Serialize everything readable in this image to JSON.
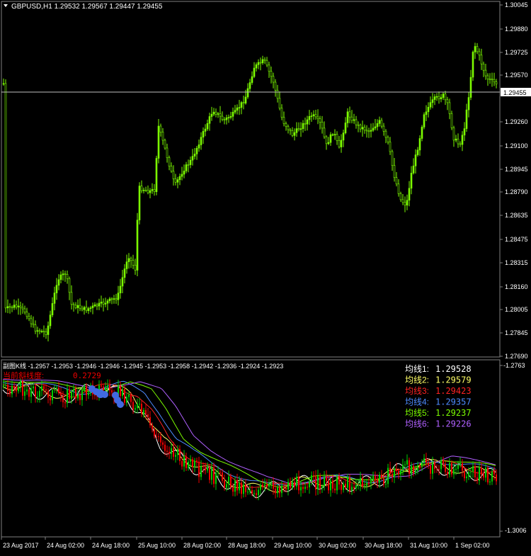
{
  "main_chart": {
    "symbol_header": "GBPUSD,H1  1.29532 1.29567 1.29447 1.29455",
    "price_axis": [
      "1.30045",
      "1.29880",
      "1.29725",
      "1.29570",
      "1.29455",
      "1.29260",
      "1.29100",
      "1.28945",
      "1.28790",
      "1.28635",
      "1.28475",
      "1.28315",
      "1.28160",
      "1.28005",
      "1.27845",
      "1.27690"
    ],
    "current_price_label": "1.29455",
    "colors": {
      "background": "#000000",
      "candle": "#7cfc00",
      "text": "#ffffff",
      "bid_line": "#c0c0c0"
    }
  },
  "indicator": {
    "header": "副图K线 -1.2957 -1.2953 -1.2946 -1.2946 -1.2945 -1.2953 -1.2958 -1.2942 -1.2936 -1.2924 -1.2923",
    "current_slope_label": "当前斜线度:",
    "current_slope_value": "0.2729",
    "axis_top": "-1.2763",
    "axis_bottom": "-1.3006",
    "ma_legend": [
      {
        "label": "均线1:",
        "value": "1.29528",
        "color": "#ffffff"
      },
      {
        "label": "均线2:",
        "value": "1.29579",
        "color": "#ffff66"
      },
      {
        "label": "均线3:",
        "value": "1.29423",
        "color": "#ff2222"
      },
      {
        "label": "均线4:",
        "value": "1.29357",
        "color": "#4e8cff"
      },
      {
        "label": "均线5:",
        "value": "1.29237",
        "color": "#7cfc00"
      },
      {
        "label": "均线6:",
        "value": "1.29226",
        "color": "#b060ff"
      }
    ],
    "colors": {
      "up": "#00cc00",
      "down": "#ee0000",
      "highlight": "#4169e1"
    }
  },
  "time_axis": [
    "23 Aug 2017",
    "24 Aug 02:00",
    "24 Aug 18:00",
    "25 Aug 10:00",
    "28 Aug 02:00",
    "28 Aug 18:00",
    "29 Aug 10:00",
    "30 Aug 02:00",
    "30 Aug 18:00",
    "31 Aug 10:00",
    "1 Sep 02:00"
  ]
}
